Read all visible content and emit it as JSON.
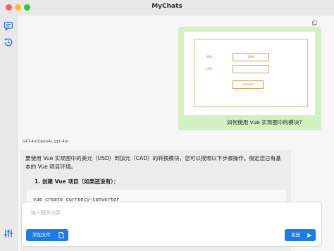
{
  "window": {
    "title": "MyChats"
  },
  "sidebar": {
    "items": [
      {
        "name": "chat-list-icon"
      },
      {
        "name": "history-icon"
      },
      {
        "name": "settings-sliders-icon"
      }
    ]
  },
  "user_message": {
    "text": "如何使用 vue 实现图中的模块?",
    "image": {
      "usd_label": "USD:",
      "usd_value": "1000",
      "cad_label": "CAD:",
      "cad_value": "",
      "convert_label": "Convert"
    }
  },
  "assistant_message": {
    "model": "GPT-4o(OpenAI, gpt-4o)",
    "paragraph": "要使用 Vue 实现图中的美元（USD）到加元（CAD）的转换模块，您可以按照以下步骤操作。假定您已有基本的 Vue 项目环境。",
    "step_1": "1.  创建 Vue 项目（如果还没有）：",
    "code": "vue create currency-converter"
  },
  "composer": {
    "placeholder": "输入聊天内容",
    "upload_label": "添加文件",
    "send_label": "发送"
  },
  "colors": {
    "accent": "#1e7be0",
    "user_bubble": "#d3f0c4",
    "mockup_line": "#e39a55"
  }
}
